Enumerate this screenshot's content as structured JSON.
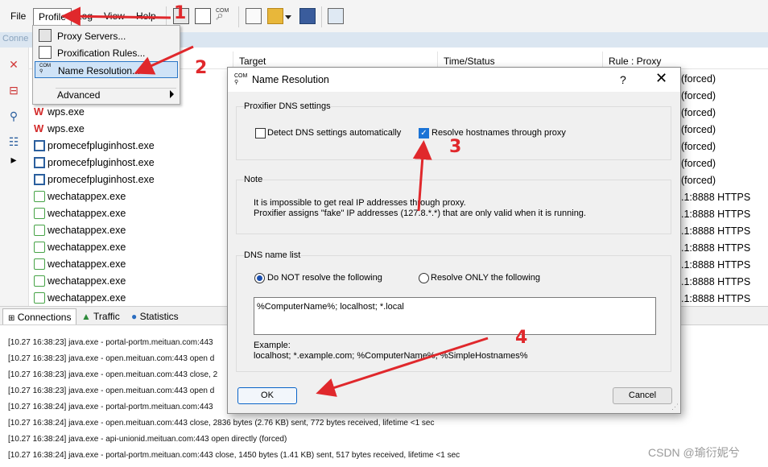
{
  "menubar": {
    "file": "File",
    "profile": "Profile",
    "log": "Log",
    "view": "View",
    "help": "Help"
  },
  "conn_strip_label": "Conne",
  "table": {
    "headers": [
      "Target",
      "Time/Status",
      "Rule : Proxy"
    ],
    "rows": [
      {
        "app": "wps.exe",
        "icon": "wps-icon",
        "rule": "(forced)"
      },
      {
        "app": "wps.exe",
        "icon": "wps-icon",
        "rule": "(forced)"
      },
      {
        "app": "promecefpluginhost.exe",
        "icon": "cef-icon",
        "rule": "(forced)"
      },
      {
        "app": "promecefpluginhost.exe",
        "icon": "cef-icon",
        "rule": "(forced)"
      },
      {
        "app": "promecefpluginhost.exe",
        "icon": "cef-icon",
        "rule": "(forced)"
      },
      {
        "app": "wechatappex.exe",
        "icon": "wechat-icon",
        "rule": ".1:8888 HTTPS"
      },
      {
        "app": "wechatappex.exe",
        "icon": "wechat-icon",
        "rule": ".1:8888 HTTPS"
      },
      {
        "app": "wechatappex.exe",
        "icon": "wechat-icon",
        "rule": ".1:8888 HTTPS"
      },
      {
        "app": "wechatappex.exe",
        "icon": "wechat-icon",
        "rule": ".1:8888 HTTPS"
      },
      {
        "app": "wechatappex.exe",
        "icon": "wechat-icon",
        "rule": ".1:8888 HTTPS"
      },
      {
        "app": "wechatappex.exe",
        "icon": "wechat-icon",
        "rule": ".1:8888 HTTPS"
      },
      {
        "app": "wechatappex.exe",
        "icon": "wechat-icon",
        "rule": ".1:8888 HTTPS"
      }
    ],
    "extra_rules_top": [
      "(forced)",
      "(forced)"
    ]
  },
  "tabs": [
    "Connections",
    "Traffic",
    "Statistics"
  ],
  "log": [
    "[10.27 16:38:23] java.exe - portal-portm.meituan.com:443",
    "[10.27 16:38:23] java.exe - open.meituan.com:443 open d",
    "[10.27 16:38:23] java.exe - open.meituan.com:443 close, 2",
    "[10.27 16:38:23] java.exe - open.meituan.com:443 open d",
    "[10.27 16:38:24] java.exe - portal-portm.meituan.com:443",
    "[10.27 16:38:24] java.exe - open.meituan.com:443 close, 2836 bytes (2.76 KB) sent, 772 bytes received, lifetime <1 sec",
    "[10.27 16:38:24] java.exe - api-unionid.meituan.com:443 open directly (forced)",
    "[10.27 16:38:24] java.exe - portal-portm.meituan.com:443 close, 1450 bytes (1.41 KB) sent, 517 bytes received, lifetime <1 sec"
  ],
  "dropdown": {
    "items": [
      "Proxy Servers...",
      "Proxification Rules...",
      "Name Resolution...",
      "Advanced"
    ]
  },
  "dialog": {
    "title": "Name Resolution",
    "help": "?",
    "close": "✕",
    "dns_group": "Proxifier DNS settings",
    "detect_label": "Detect DNS settings automatically",
    "detect_checked": false,
    "resolve_label": "Resolve hostnames through proxy",
    "resolve_checked": true,
    "note_group": "Note",
    "note_line1": "It is impossible to get real IP addresses through proxy.",
    "note_line2": "Proxifier assigns \"fake\" IP addresses (127.8.*.*) that are only valid when it is running.",
    "dnslist_group": "DNS name list",
    "radio_not": "Do NOT resolve the following",
    "radio_only": "Resolve ONLY the following",
    "radio_selected": "not",
    "input_value": "%ComputerName%; localhost; *.local",
    "example_label": "Example:",
    "example_text": "localhost; *.example.com; %ComputerName%; %SimpleHostnames%",
    "ok": "OK",
    "cancel": "Cancel"
  },
  "annotations": [
    "1",
    "2",
    "3",
    "4"
  ],
  "watermark": "CSDN @瑜衍妮兮",
  "colors": {
    "annotation": "#e0282c",
    "accent": "#1a73d6"
  }
}
